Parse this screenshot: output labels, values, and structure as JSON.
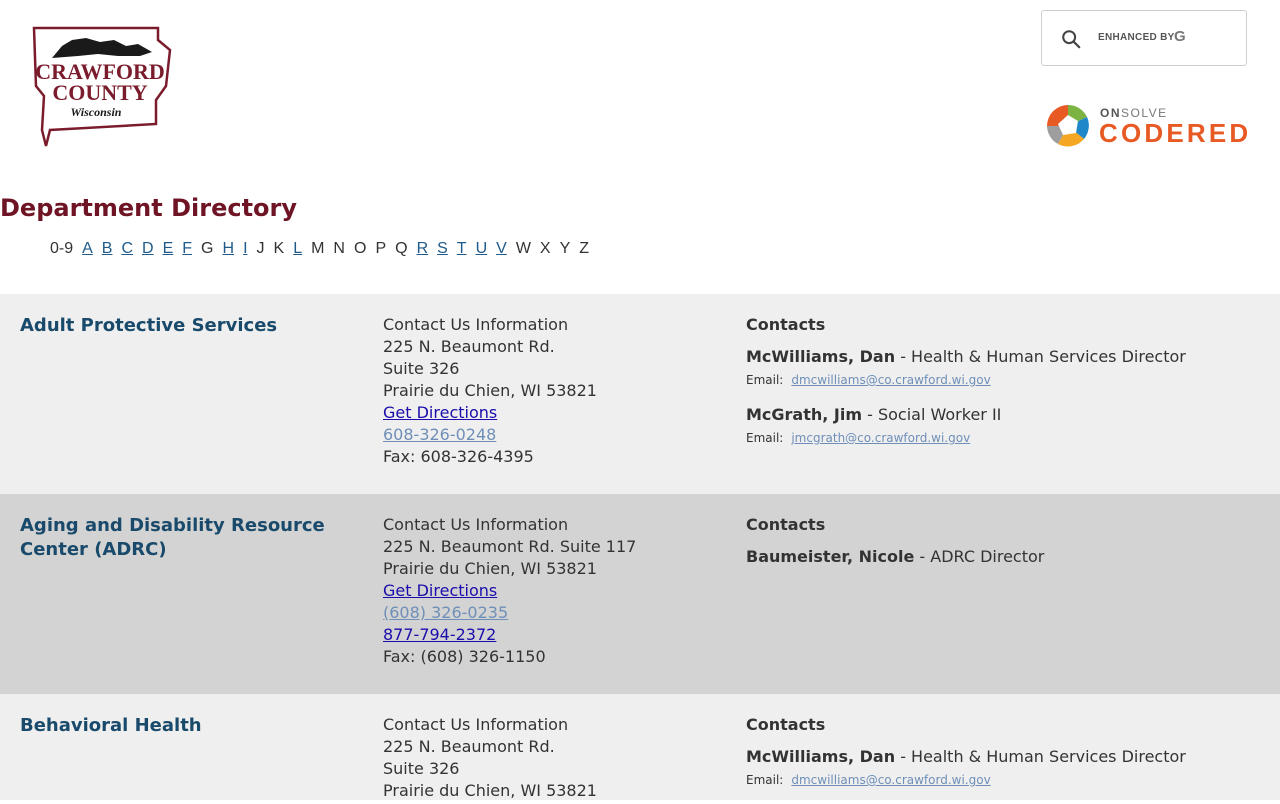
{
  "header": {
    "logo": {
      "line1": "CRAWFORD",
      "line2": "COUNTY",
      "line3": "Wisconsin"
    },
    "search": {
      "enhanced_by": "ENHANCED BY",
      "g": "G"
    },
    "codered": {
      "onsolve_on": "ON",
      "onsolve_rest": "SOLVE",
      "name": "CODERED"
    }
  },
  "page_title": "Department Directory",
  "alphabet": [
    {
      "label": "0-9",
      "link": false
    },
    {
      "label": "A",
      "link": true
    },
    {
      "label": "B",
      "link": true
    },
    {
      "label": "C",
      "link": true
    },
    {
      "label": "D",
      "link": true
    },
    {
      "label": "E",
      "link": true
    },
    {
      "label": "F",
      "link": true
    },
    {
      "label": "G",
      "link": false
    },
    {
      "label": "H",
      "link": true
    },
    {
      "label": "I",
      "link": true
    },
    {
      "label": "J",
      "link": false
    },
    {
      "label": "K",
      "link": false
    },
    {
      "label": "L",
      "link": true
    },
    {
      "label": "M",
      "link": false
    },
    {
      "label": "N",
      "link": false
    },
    {
      "label": "O",
      "link": false
    },
    {
      "label": "P",
      "link": false
    },
    {
      "label": "Q",
      "link": false
    },
    {
      "label": "R",
      "link": true
    },
    {
      "label": "S",
      "link": true
    },
    {
      "label": "T",
      "link": true
    },
    {
      "label": "U",
      "link": true
    },
    {
      "label": "V",
      "link": true
    },
    {
      "label": "W",
      "link": false
    },
    {
      "label": "X",
      "link": false
    },
    {
      "label": "Y",
      "link": false
    },
    {
      "label": "Z",
      "link": false
    }
  ],
  "departments": [
    {
      "name": "Adult Protective Services",
      "info_title": "Contact Us Information",
      "address_lines": [
        "225 N. Beaumont Rd.",
        "Suite 326",
        "Prairie du Chien, WI 53821"
      ],
      "directions": "Get Directions",
      "phone": "608-326-0248",
      "fax": "Fax: 608-326-4395",
      "contacts_heading": "Contacts",
      "contacts": [
        {
          "name": "McWilliams, Dan",
          "title": " - Health & Human Services Director",
          "email_label": "Email:",
          "email": "dmcwilliams@co.crawford.wi.gov"
        },
        {
          "name": "McGrath, Jim",
          "title": " - Social Worker II",
          "email_label": "Email:",
          "email": "jmcgrath@co.crawford.wi.gov"
        }
      ]
    },
    {
      "name": "Aging and Disability Resource Center (ADRC)",
      "info_title": "Contact Us Information",
      "address_lines": [
        "225 N. Beaumont Rd. Suite 117",
        "Prairie du Chien, WI 53821"
      ],
      "directions": "Get Directions",
      "phone": "(608) 326-0235",
      "phone2": "877-794-2372",
      "fax": "Fax: (608) 326-1150",
      "contacts_heading": "Contacts",
      "contacts": [
        {
          "name": "Baumeister, Nicole",
          "title": " - ADRC Director"
        }
      ]
    },
    {
      "name": "Behavioral Health",
      "info_title": "Contact Us Information",
      "address_lines": [
        "225 N. Beaumont Rd.",
        "Suite 326",
        "Prairie du Chien, WI 53821"
      ],
      "contacts_heading": "Contacts",
      "contacts": [
        {
          "name": "McWilliams, Dan",
          "title": " - Health & Human Services Director",
          "email_label": "Email:",
          "email": "dmcwilliams@co.crawford.wi.gov"
        }
      ]
    }
  ]
}
